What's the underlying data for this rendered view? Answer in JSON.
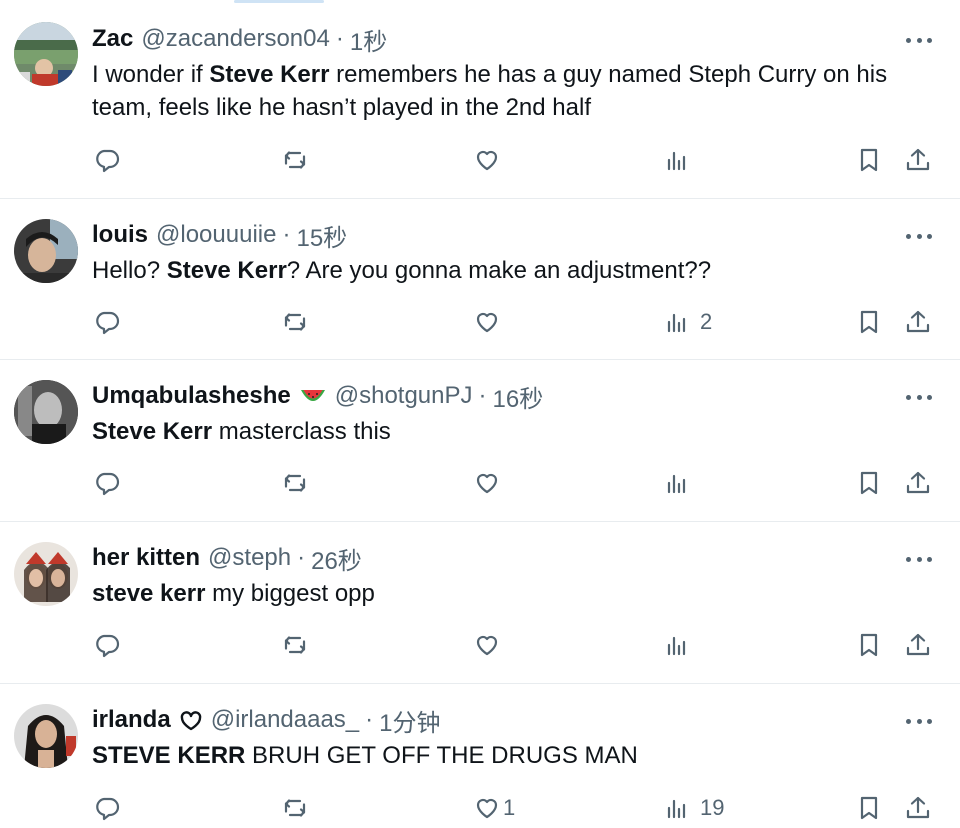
{
  "tweets": [
    {
      "name": "Zac",
      "handle": "@zacanderson04",
      "time": "1秒",
      "text_parts": [
        "I wonder if ",
        "Steve Kerr",
        " remembers he has a guy named Steph Curry on his team, feels like he hasn’t played in the 2nd half"
      ],
      "counts": {
        "replies": "",
        "retweets": "",
        "likes": "",
        "views": ""
      }
    },
    {
      "name": "louis",
      "handle": "@loouuuiie",
      "time": "15秒",
      "text_parts": [
        "Hello? ",
        "Steve Kerr",
        "? Are you gonna make an adjustment??"
      ],
      "counts": {
        "replies": "",
        "retweets": "",
        "likes": "",
        "views": "2"
      }
    },
    {
      "name": "Umqabulasheshe",
      "handle": "@shotgunPJ",
      "time": "16秒",
      "badge_icon": "watermelon-emoji-icon",
      "text_parts": [
        "",
        "Steve Kerr",
        " masterclass this"
      ],
      "counts": {
        "replies": "",
        "retweets": "",
        "likes": "",
        "views": ""
      }
    },
    {
      "name": "her kitten",
      "handle": "@steph",
      "time": "26秒",
      "text_parts": [
        "",
        "steve kerr",
        " my biggest opp"
      ],
      "counts": {
        "replies": "",
        "retweets": "",
        "likes": "",
        "views": ""
      }
    },
    {
      "name": "irlanda",
      "handle": "@irlandaaas_",
      "time": "1分钟",
      "badge_icon": "heart-outline-icon",
      "text_parts": [
        "",
        "STEVE KERR",
        " BRUH GET OFF THE DRUGS MAN"
      ],
      "counts": {
        "replies": "",
        "retweets": "",
        "likes": "1",
        "views": "19"
      }
    }
  ],
  "separator": "·",
  "colors": {
    "text": "#0f1419",
    "secondary": "#536471",
    "divider": "#e8ecef"
  },
  "icons": [
    "more-icon",
    "reply-icon",
    "retweet-icon",
    "like-icon",
    "views-icon",
    "bookmark-icon",
    "share-icon"
  ]
}
